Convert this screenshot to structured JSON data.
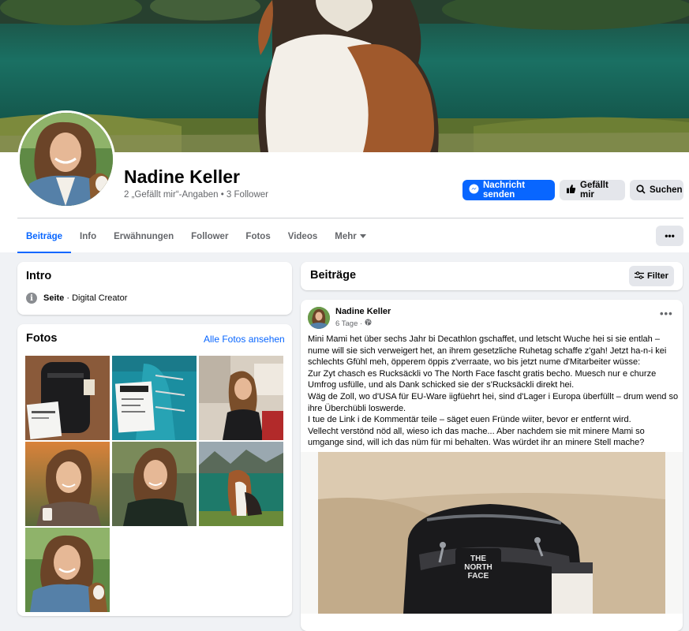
{
  "profile": {
    "name": "Nadine Keller",
    "stats": "2 „Gefällt mir“-Angaben • 3 Follower"
  },
  "actions": {
    "message": "Nachricht senden",
    "like": "Gefällt mir",
    "search": "Suchen",
    "more": "•••"
  },
  "tabs": [
    {
      "label": "Beiträge",
      "active": true
    },
    {
      "label": "Info"
    },
    {
      "label": "Erwähnungen"
    },
    {
      "label": "Follower"
    },
    {
      "label": "Fotos"
    },
    {
      "label": "Videos"
    },
    {
      "label": "Mehr"
    }
  ],
  "intro": {
    "title": "Intro",
    "category_bold": "Seite",
    "category_rest": " · Digital Creator"
  },
  "photos": {
    "title": "Fotos",
    "see_all": "Alle Fotos ansehen",
    "items": [
      {
        "desc": "backpack-receipt"
      },
      {
        "desc": "teal-backpack-receipt"
      },
      {
        "desc": "woman-kitchen"
      },
      {
        "desc": "woman-sunset-coffee"
      },
      {
        "desc": "woman-green-jacket"
      },
      {
        "desc": "beagle-lake"
      },
      {
        "desc": "woman-with-beagle"
      }
    ]
  },
  "posts_header": {
    "title": "Beiträge",
    "filter": "Filter"
  },
  "post": {
    "author": "Nadine Keller",
    "time": "6 Tage ·",
    "more": "•••",
    "paragraphs": [
      "Mini Mami het über sechs Jahr bi Decathlon gschaffet, und letscht Wuche hei si sie entlah – nume will sie sich verweigert het, an ihrem gesetzliche Ruhetag schaffe z'gah! Jetzt ha-n-i kei schlechts Gfühl meh, öpperem öppis z'verraate, wo bis jetzt nume d'Mitarbeiter wüsse:",
      "Zur Zyt chasch es Rucksäckli vo The North Face fascht gratis becho. Muesch nur e churze Umfrog usfülle, und als Dank schicked sie der s'Rucksäckli direkt hei.",
      "Wäg de Zoll, wo d'USA für EU-Ware iigfüehrt hei, sind d'Lager i Europa überfüllt – drum wend so ihre Überchübli loswerde.",
      "I tue de Link i de Kommentär teile – säget euen Fründe wiiter, bevor er entfernt wird.",
      "Vellecht verstönd nöd all, wieso ich das mache... Aber nachdem sie mit minere Mami so umgange sind, will ich das nüm für mi behalten. Was würdet ihr an minere Stell mache?"
    ],
    "image_logo_line1": "THE",
    "image_logo_line2": "NORTH",
    "image_logo_line3": "FACE"
  },
  "colors": {
    "accent": "#0866ff",
    "background": "#f0f2f5",
    "secondary_text": "#65676b"
  }
}
